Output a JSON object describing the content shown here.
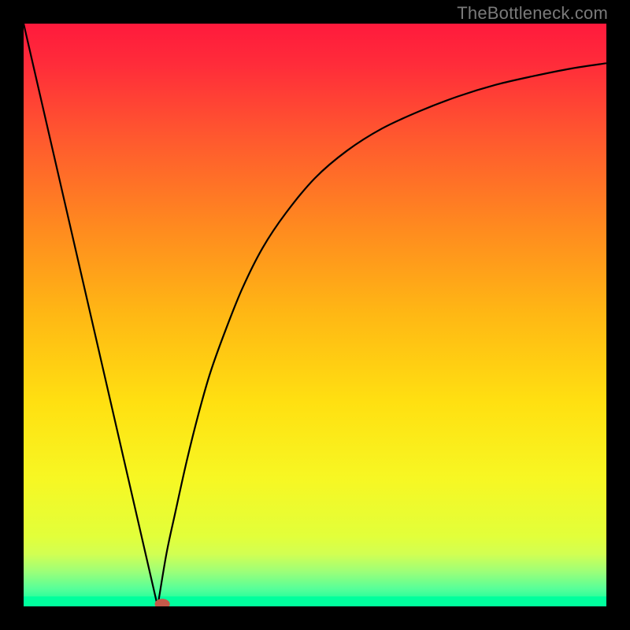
{
  "watermark": "TheBottleneck.com",
  "chart_data": {
    "type": "line",
    "title": "",
    "xlabel": "",
    "ylabel": "",
    "xlim": [
      0,
      1
    ],
    "ylim": [
      0,
      1
    ],
    "gradient_stops": [
      {
        "offset": 0.0,
        "color": "#ff1a3c"
      },
      {
        "offset": 0.07,
        "color": "#ff2c3a"
      },
      {
        "offset": 0.2,
        "color": "#ff5a2e"
      },
      {
        "offset": 0.35,
        "color": "#ff8a1f"
      },
      {
        "offset": 0.5,
        "color": "#ffb814"
      },
      {
        "offset": 0.65,
        "color": "#ffe011"
      },
      {
        "offset": 0.78,
        "color": "#f7f723"
      },
      {
        "offset": 0.88,
        "color": "#e2ff3a"
      },
      {
        "offset": 0.91,
        "color": "#d2ff52"
      },
      {
        "offset": 0.94,
        "color": "#9dff78"
      },
      {
        "offset": 0.97,
        "color": "#56ff99"
      },
      {
        "offset": 1.0,
        "color": "#00ff9d"
      }
    ],
    "baseline_band": {
      "y0": 0.983,
      "y1": 1.0,
      "color": "#00ff9d"
    },
    "series": [
      {
        "name": "left-arm",
        "type": "line",
        "x": [
          0.0,
          0.23
        ],
        "y": [
          1.0,
          0.0
        ]
      },
      {
        "name": "right-arm",
        "type": "line",
        "x": [
          0.23,
          0.245,
          0.26,
          0.28,
          0.3,
          0.32,
          0.345,
          0.375,
          0.41,
          0.45,
          0.5,
          0.555,
          0.615,
          0.68,
          0.745,
          0.81,
          0.875,
          0.94,
          1.0
        ],
        "y": [
          0.0,
          0.09,
          0.16,
          0.25,
          0.33,
          0.4,
          0.47,
          0.545,
          0.615,
          0.675,
          0.735,
          0.782,
          0.82,
          0.85,
          0.875,
          0.895,
          0.91,
          0.923,
          0.932
        ]
      }
    ],
    "marker": {
      "x": 0.238,
      "y": 0.004,
      "rx": 0.013,
      "ry": 0.009,
      "color": "#c45a4a"
    }
  }
}
